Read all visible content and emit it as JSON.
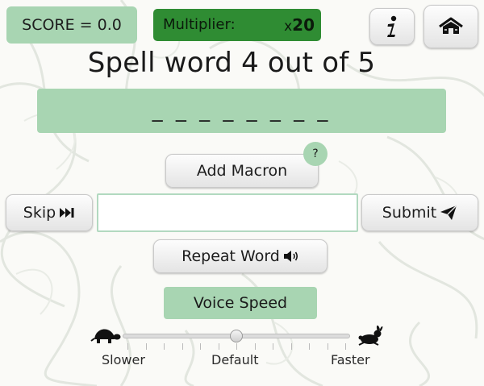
{
  "header": {
    "score_text": "SCORE = 0.0",
    "multiplier_label": "Multiplier:",
    "multiplier_prefix": "x",
    "multiplier_value": "20"
  },
  "toolbar": {
    "info_icon": "info-icon",
    "home_icon": "home-icon"
  },
  "main": {
    "title": "Spell word 4 out of 5",
    "word_mask": "_ _ _ _ _ _ _ _",
    "add_macron_label": "Add Macron",
    "help_badge": "?",
    "skip_label": "Skip",
    "answer_value": "",
    "submit_label": "Submit",
    "repeat_word_label": "Repeat Word"
  },
  "voice_speed": {
    "label": "Voice Speed",
    "slower_label": "Slower",
    "default_label": "Default",
    "faster_label": "Faster",
    "value_fraction": 0.5,
    "tick_count": 13
  },
  "colors": {
    "badge_green": "#a8d5b2",
    "multiplier_green": "#2f8c33"
  }
}
